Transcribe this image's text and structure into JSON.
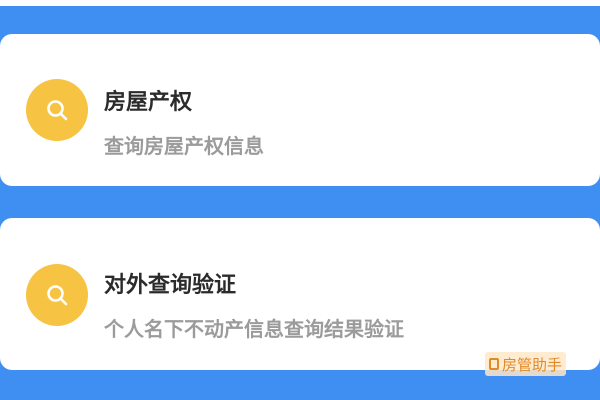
{
  "cards": [
    {
      "title": "房屋产权",
      "description": "查询房屋产权信息",
      "icon": "search-icon"
    },
    {
      "title": "对外查询验证",
      "description": "个人名下不动产信息查询结果验证",
      "icon": "search-icon"
    }
  ],
  "watermark": {
    "text": "房管助手"
  },
  "colors": {
    "background": "#3f8ff3",
    "icon_circle": "#f6c343",
    "title": "#2b2b2b",
    "description": "#9b9b9b"
  }
}
